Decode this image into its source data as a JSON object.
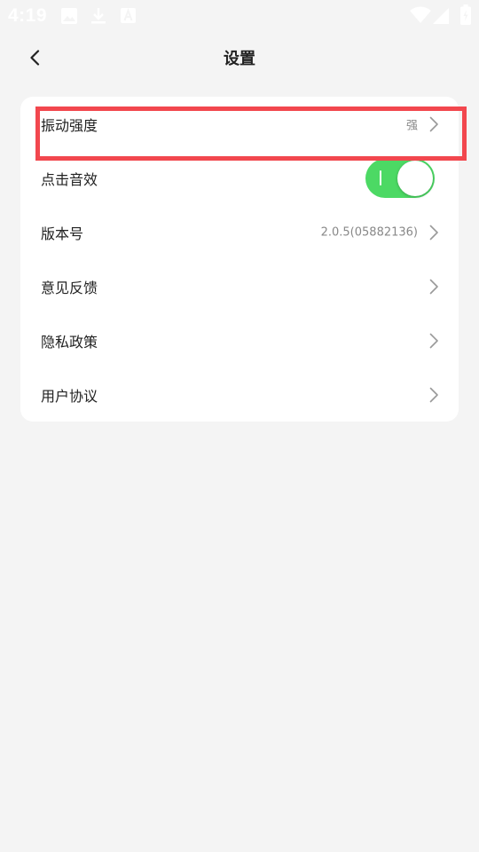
{
  "status_bar": {
    "time": "4:19",
    "icons": [
      "image-icon",
      "download-icon",
      "font-a-icon",
      "wifi-icon",
      "signal-icon",
      "battery-icon"
    ]
  },
  "header": {
    "title": "设置",
    "back_icon": "chevron-left-icon"
  },
  "settings": {
    "items": [
      {
        "label": "振动强度",
        "value": "强",
        "type": "nav"
      },
      {
        "label": "点击音效",
        "value": "",
        "type": "toggle",
        "toggle_on": true
      },
      {
        "label": "版本号",
        "value": "2.0.5(05882136)",
        "type": "nav"
      },
      {
        "label": "意见反馈",
        "value": "",
        "type": "nav"
      },
      {
        "label": "隐私政策",
        "value": "",
        "type": "nav"
      },
      {
        "label": "用户协议",
        "value": "",
        "type": "nav"
      }
    ]
  },
  "colors": {
    "background": "#f4f4f4",
    "card": "#ffffff",
    "toggle_on": "#4cd964",
    "highlight": "#f2474e",
    "status_icons": "#ffffff"
  }
}
